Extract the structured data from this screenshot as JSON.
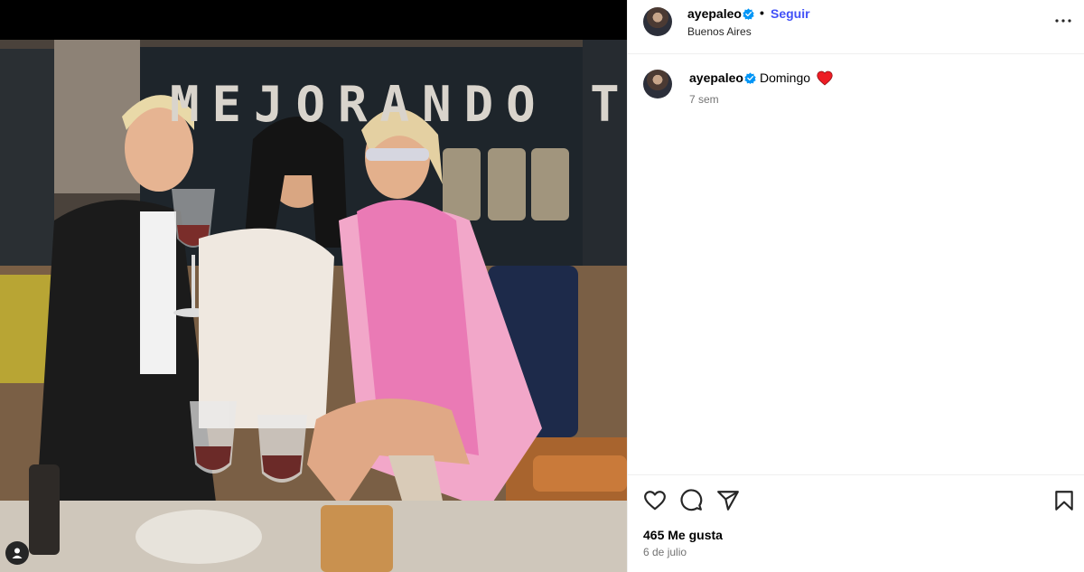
{
  "post": {
    "username": "ayepaleo",
    "follow_label": "Seguir",
    "separator": "•",
    "location": "Buenos Aires",
    "caption": {
      "username": "ayepaleo",
      "text": "Domingo",
      "emoji_icon": "red-heart-icon",
      "time_ago": "7 sem"
    },
    "likes": "465 Me gusta",
    "date": "6 de julio"
  },
  "media": {
    "sign_text": "MEJORANDO TU",
    "tagged_user_icon": "user-icon"
  },
  "icons": {
    "verified": "verified-badge-icon",
    "more": "more-options-icon",
    "like": "heart-outline-icon",
    "comment": "comment-icon",
    "share": "share-icon",
    "save": "bookmark-icon"
  },
  "colors": {
    "follow": "#4150f7",
    "verified": "#0095f6",
    "heart": "#ed1c24",
    "muted": "#737373"
  }
}
